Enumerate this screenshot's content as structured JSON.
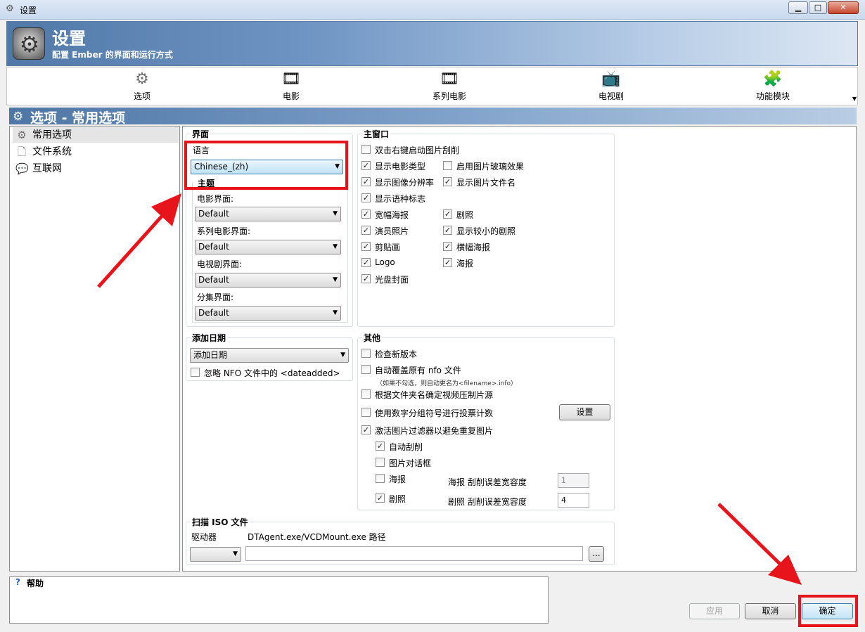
{
  "window": {
    "title": "设置"
  },
  "banner": {
    "title": "设置",
    "subtitle": "配置 Ember 的界面和运行方式"
  },
  "toolbar": {
    "items": [
      {
        "label": "选项",
        "icon": "gear-icon"
      },
      {
        "label": "电影",
        "icon": "film-icon"
      },
      {
        "label": "系列电影",
        "icon": "film-stack-icon"
      },
      {
        "label": "电视剧",
        "icon": "tv-icon"
      },
      {
        "label": "功能模块",
        "icon": "puzzle-icon"
      }
    ]
  },
  "section": {
    "title": "选项 - 常用选项"
  },
  "tree": {
    "items": [
      {
        "label": "常用选项",
        "icon": "gear-icon"
      },
      {
        "label": "文件系统",
        "icon": "file-icon"
      },
      {
        "label": "互联网",
        "icon": "chat-icon"
      }
    ]
  },
  "interface": {
    "title": "界面",
    "language_label": "语言",
    "language_value": "Chinese_(zh)",
    "theme_title": "主题",
    "movie_theme_label": "电影界面:",
    "movie_theme_value": "Default",
    "movieset_theme_label": "系列电影界面:",
    "movieset_theme_value": "Default",
    "tv_theme_label": "电视剧界面:",
    "tv_theme_value": "Default",
    "episode_theme_label": "分集界面:",
    "episode_theme_value": "Default"
  },
  "mainwindow": {
    "title": "主窗口",
    "checks": [
      {
        "label": "双击右键启动图片刮削",
        "checked": false
      },
      {
        "label": "显示电影类型",
        "checked": true
      },
      {
        "label": "启用图片玻璃效果",
        "checked": false
      },
      {
        "label": "显示图像分辨率",
        "checked": true
      },
      {
        "label": "显示图片文件名",
        "checked": true
      },
      {
        "label": "显示语种标志",
        "checked": true
      },
      {
        "label": "宽幅海报",
        "checked": true
      },
      {
        "label": "剧照",
        "checked": true
      },
      {
        "label": "演员照片",
        "checked": true
      },
      {
        "label": "显示较小的剧照",
        "checked": true
      },
      {
        "label": "剪贴画",
        "checked": true
      },
      {
        "label": "横幅海报",
        "checked": true
      },
      {
        "label": "Logo",
        "checked": true
      },
      {
        "label": "海报",
        "checked": true
      },
      {
        "label": "光盘封面",
        "checked": true
      }
    ]
  },
  "dateadded": {
    "title": "添加日期",
    "combo_value": "添加日期",
    "ignore_label": "忽略 NFO 文件中的 <dateadded>",
    "ignore_checked": false
  },
  "misc": {
    "title": "其他",
    "check_update": "检查新版本",
    "overwrite_nfo": "自动覆盖原有 nfo 文件",
    "overwrite_note": "（如果不勾选，则自动更名为<filename>.info）",
    "folder_codec": "根据文件夹名确定视频压制片源",
    "digit_grouping": "使用数字分组符号进行投票计数",
    "settings_button": "设置",
    "image_filter": "激活图片过滤器以避免重复图片",
    "auto_scrape": "自动刮削",
    "image_dialog": "图片对话框",
    "poster": "海报",
    "poster_tolerance_label": "海报 刮削误差宽容度",
    "poster_tolerance_value": "1",
    "fanart": "剧照",
    "fanart_tolerance_label": "剧照 刮削误差宽容度",
    "fanart_tolerance_value": "4"
  },
  "iso": {
    "title": "扫描 ISO 文件",
    "drive_label": "驱动器",
    "path_label": "DTAgent.exe/VCDMount.exe 路径",
    "drive_value": "",
    "path_value": "",
    "browse_label": "..."
  },
  "help": {
    "title": "帮助",
    "icon": "question-icon"
  },
  "buttons": {
    "apply": "应用",
    "cancel": "取消",
    "ok": "确定"
  },
  "colors": {
    "annotation": "#e8141b",
    "banner": "#5179a8"
  }
}
